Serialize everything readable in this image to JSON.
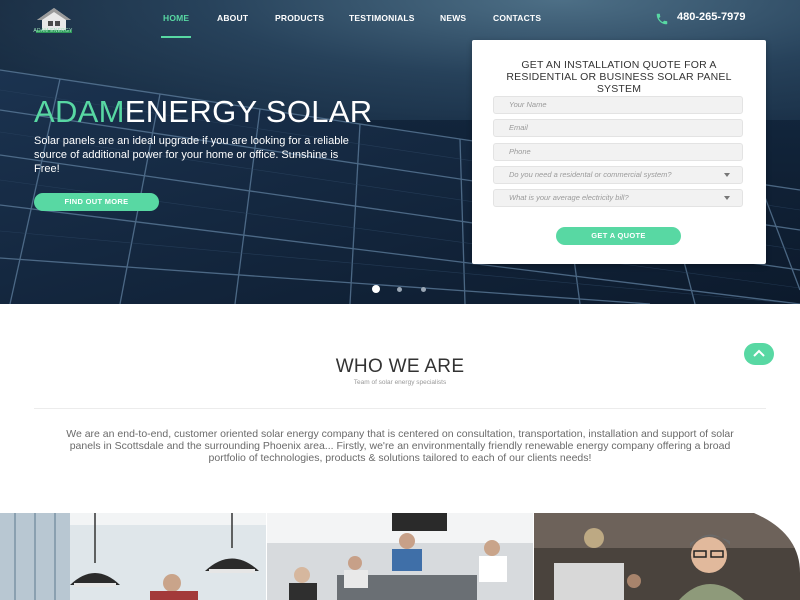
{
  "logo": {
    "text": "ADAM ENERGY"
  },
  "nav": {
    "items": [
      "HOME",
      "ABOUT",
      "PRODUCTS",
      "TESTIMONIALS",
      "NEWS",
      "CONTACTS"
    ],
    "active": "HOME"
  },
  "phone": "480-265-7979",
  "hero": {
    "title_accent": "ADAM",
    "title_rest": "ENERGY SOLAR",
    "description": "Solar panels are an ideal upgrade if you are looking for a reliable source of additional power for your home or office. Sunshine is Free!",
    "button": "FIND OUT MORE"
  },
  "quote": {
    "title": "GET AN INSTALLATION QUOTE FOR A RESIDENTIAL OR BUSINESS SOLAR PANEL SYSTEM",
    "name_placeholder": "Your Name",
    "email_placeholder": "Email",
    "phone_placeholder": "Phone",
    "system_select": "Do you need a residental or commercial system?",
    "bill_select": "What is your average electricity bill?",
    "button": "GET A QUOTE"
  },
  "slider": {
    "dots": 3,
    "active": 1
  },
  "about": {
    "title": "WHO WE ARE",
    "subtitle": "Team of solar energy specialists",
    "text": "We are an end-to-end, customer oriented solar energy company that is centered on consultation, transportation, installation and support of solar panels in Scottsdale and the surrounding Phoenix area... Firstly, we're an environmentally friendly renewable energy company offering a broad portfolio of technologies, products & solutions tailored to each of our clients needs!"
  },
  "colors": {
    "accent": "#58d8a3",
    "hero_dark": "#0f1c2e",
    "text": "#333333"
  }
}
